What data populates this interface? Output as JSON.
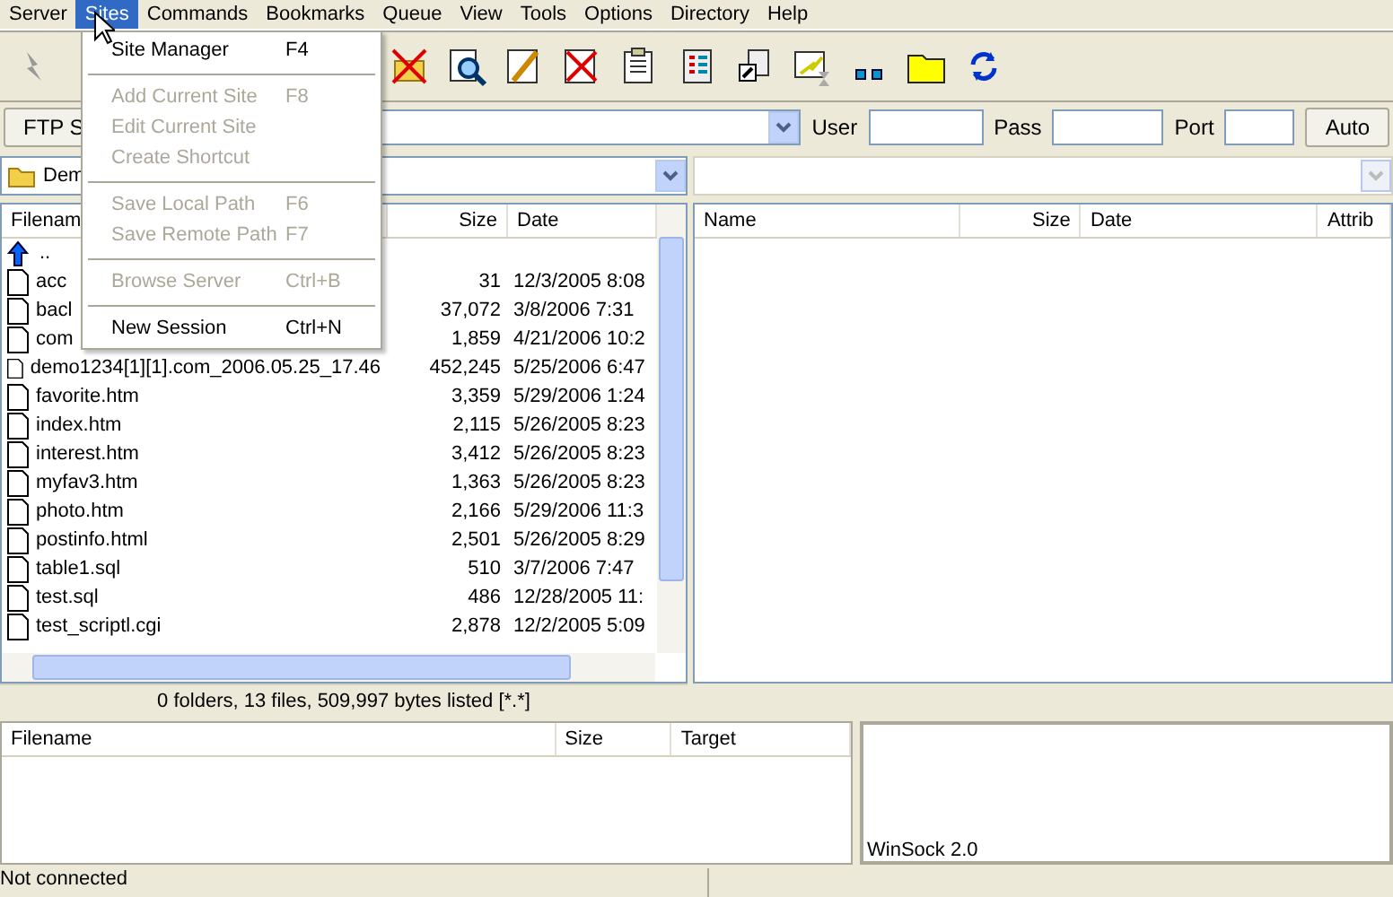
{
  "menubar": [
    {
      "label": "Server",
      "selected": false
    },
    {
      "label": "Sites",
      "selected": true
    },
    {
      "label": "Commands",
      "selected": false
    },
    {
      "label": "Bookmarks",
      "selected": false
    },
    {
      "label": "Queue",
      "selected": false
    },
    {
      "label": "View",
      "selected": false
    },
    {
      "label": "Tools",
      "selected": false
    },
    {
      "label": "Options",
      "selected": false
    },
    {
      "label": "Directory",
      "selected": false
    },
    {
      "label": "Help",
      "selected": false
    }
  ],
  "menu": {
    "items": [
      {
        "kind": "item",
        "label": "Site Manager",
        "shortcut": "F4",
        "disabled": false
      },
      {
        "kind": "separator"
      },
      {
        "kind": "item",
        "label": "Add Current Site",
        "shortcut": "F8",
        "disabled": true
      },
      {
        "kind": "item",
        "label": "Edit Current Site",
        "disabled": true
      },
      {
        "kind": "item",
        "label": "Create Shortcut",
        "disabled": true
      },
      {
        "kind": "separator"
      },
      {
        "kind": "item",
        "label": "Save Local Path",
        "shortcut": "F6",
        "disabled": true
      },
      {
        "kind": "item",
        "label": "Save Remote Path",
        "shortcut": "F7",
        "disabled": true
      },
      {
        "kind": "separator"
      },
      {
        "kind": "item",
        "label": "Browse Server",
        "shortcut": "Ctrl+B",
        "disabled": true
      },
      {
        "kind": "separator"
      },
      {
        "kind": "item",
        "label": "New Session",
        "shortcut": "Ctrl+N",
        "disabled": false
      }
    ]
  },
  "connection": {
    "type_button": "FTP S",
    "user_label": "User",
    "pass_label": "Pass",
    "port_label": "Port",
    "auto_button": "Auto"
  },
  "local": {
    "path": "Dem",
    "columns": [
      "Filenam",
      "Size",
      "Date"
    ],
    "rows": [
      {
        "kind": "parent",
        "name": ".."
      },
      {
        "kind": "file",
        "name": "acc",
        "size": "31",
        "date": "12/3/2005 8:08"
      },
      {
        "kind": "file",
        "name": "bacl",
        "size": "37,072",
        "date": "3/8/2006 7:31"
      },
      {
        "kind": "file",
        "name": "com",
        "size": "1,859",
        "date": "4/21/2006 10:2"
      },
      {
        "kind": "file",
        "name": "demo1234[1][1].com_2006.05.25_17.46",
        "size": "452,245",
        "date": "5/25/2006 6:47"
      },
      {
        "kind": "file",
        "name": "favorite.htm",
        "size": "3,359",
        "date": "5/29/2006 1:24"
      },
      {
        "kind": "file",
        "name": "index.htm",
        "size": "2,115",
        "date": "5/26/2005 8:23"
      },
      {
        "kind": "file",
        "name": "interest.htm",
        "size": "3,412",
        "date": "5/26/2005 8:23"
      },
      {
        "kind": "file",
        "name": "myfav3.htm",
        "size": "1,363",
        "date": "5/26/2005 8:23"
      },
      {
        "kind": "file",
        "name": "photo.htm",
        "size": "2,166",
        "date": "5/29/2006 11:3"
      },
      {
        "kind": "file",
        "name": "postinfo.html",
        "size": "2,501",
        "date": "5/26/2005 8:29"
      },
      {
        "kind": "file",
        "name": "table1.sql",
        "size": "510",
        "date": "3/7/2006 7:47"
      },
      {
        "kind": "file",
        "name": "test.sql",
        "size": "486",
        "date": "12/28/2005 11:"
      },
      {
        "kind": "file",
        "name": "test_scriptl.cgi",
        "size": "2,878",
        "date": "12/2/2005 5:09"
      }
    ],
    "status": "0 folders, 13 files, 509,997 bytes listed [*.*]"
  },
  "remote": {
    "columns": [
      "Name",
      "Size",
      "Date",
      "Attrib"
    ]
  },
  "queue": {
    "columns": [
      "Filename",
      "Size",
      "Target"
    ]
  },
  "log": {
    "lines": [
      "WinSock 2.0"
    ]
  },
  "status_bar": "Not connected"
}
